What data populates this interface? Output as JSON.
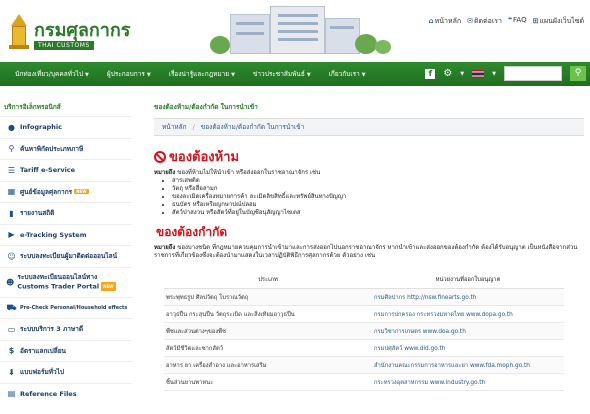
{
  "header": {
    "logo_title": "กรมศุลกากร",
    "logo_subtitle": "THAI CUSTOMS",
    "toplinks": [
      {
        "icon": "home-icon",
        "label": "หน้าหลัก"
      },
      {
        "icon": "mail-icon",
        "label": "ติดต่อเรา"
      },
      {
        "icon": "faq-icon",
        "label": "FAQ"
      },
      {
        "icon": "sitemap-icon",
        "label": "แผนผังเว็บไซต์"
      }
    ]
  },
  "nav": {
    "items": [
      "นักท่องเที่ยว/บุคคลทั่วไป",
      "ผู้ประกอบการ",
      "เรื่องน่ารู้และกฎหมาย",
      "ข่าวประชาสัมพันธ์",
      "เกี่ยวกับเรา"
    ]
  },
  "sidebar": {
    "title": "บริการอิเล็กทรอนิกส์",
    "items": [
      {
        "icon": "info-icon",
        "label": "Infographic",
        "badge": ""
      },
      {
        "icon": "search-icon",
        "label": "ค้นหาพิกัดประเภทภาษี",
        "badge": ""
      },
      {
        "icon": "list-icon",
        "label": "Tariff e-Service",
        "badge": ""
      },
      {
        "icon": "calendar-icon",
        "label": "ศูนย์ข้อมูลศุลกากร",
        "badge": "NEW"
      },
      {
        "icon": "bar-chart-icon",
        "label": "รายงานสถิติ",
        "badge": ""
      },
      {
        "icon": "truck-icon",
        "label": "e-Tracking System",
        "badge": ""
      },
      {
        "icon": "user-icon",
        "label": "ระบบลงทะเบียนผู้มาติดต่อออนไลน์",
        "badge": ""
      },
      {
        "icon": "users-icon",
        "label": "ระบบลงทะเบียนออนไลน์ทาง Customs Trader Portal",
        "badge": "NEW"
      },
      {
        "icon": "car-icon",
        "label": "Pre-Check Personal/Household effects",
        "badge": ""
      },
      {
        "icon": "monitor-icon",
        "label": "ระบบบริการ 3 ภาษาดี",
        "badge": ""
      },
      {
        "icon": "dollar-icon",
        "label": "อัตราแลกเปลี่ยน",
        "badge": ""
      },
      {
        "icon": "download-icon",
        "label": "แบบฟอร์มทั่วไป",
        "badge": ""
      },
      {
        "icon": "file-icon",
        "label": "Reference Files",
        "badge": ""
      }
    ]
  },
  "main": {
    "page_heading": "ของต้องห้าม/ต้องกำกัด ในการนำเข้า",
    "breadcrumb": [
      "หน้าหลัก",
      "ของต้องห้าม/ต้องกำกัด ในการนำเข้า"
    ],
    "prohibited_title": "ของต้องห้าม",
    "prohibited_intro_bold": "หมายถึง",
    "prohibited_intro": " ของที่ห้ามไม่ให้นำเข้า หรือส่งออกในราชอาณาจักร เช่น",
    "prohibited_items": [
      "สารเสพติด",
      "วัตถุ หรือสื่อลามก",
      "ของละเมิดเครื่องหมายการค้า ละเมิดลิขสิทธิ์และทรัพย์สินทางปัญญา",
      "ธนบัตร หรือเหรียญกษาปณ์ปลอม",
      "สัตว์ป่าสงวน หรือสัตว์ที่อยู่ในบัญชีอนุสัญญาไซเตส"
    ],
    "restricted_title": "ของต้องกำกัด",
    "restricted_intro_bold": "หมายถึง",
    "restricted_intro": " ของบางชนิด ที่กฎหมายควบคุมการนำเข้ามาและการส่งออกไปนอกราชอาณาจักร หากนำเข้าและส่งออกของต้องกำกัด ต้องได้รับอนุญาต เป็นหนังสือจากส่วนราชการที่เกี่ยวข้องซึ่งจะต้องนำมาแสดงในเวลาปฏิบัติพิธีการศุลกากรด้วย ตัวอย่าง เช่น",
    "table_headers": [
      "ประเภท",
      "หน่วยงานที่ออกใบอนุญาต"
    ],
    "table_rows": [
      [
        "พระพุทธรูป ศิลปวัตถุ โบราณวัตถุ",
        "กรมศิลปากร http://nsw.finearts.go.th"
      ],
      [
        "อาวุธปืน กระสุนปืน วัตถุระเบิด และสิ่งเทียมอาวุธปืน",
        "กรมการปกครอง กระทรวงมหาดไทย www.dopa.go.th"
      ],
      [
        "พืชและส่วนต่างๆของพืช",
        "กรมวิชาการเกษตร www.doa.go.th"
      ],
      [
        "สัตว์มีชีวิตและซากสัตว์",
        "กรมปศุสัตว์ www.dld.go.th"
      ],
      [
        "อาหาร ยา เครื่องสำอาง และอาหารเสริม",
        "สำนักงานคณะกรรมการอาหารและยา www.fda.moph.go.th"
      ],
      [
        "ชิ้นส่วนยานพาหนะ",
        "กระทรวงอุตสาหกรรม www.industry.go.th"
      ]
    ]
  },
  "colors": {
    "brand_green": "#2a7a2a",
    "alert_red": "#d0141c",
    "link_blue": "#2a5a8a"
  }
}
